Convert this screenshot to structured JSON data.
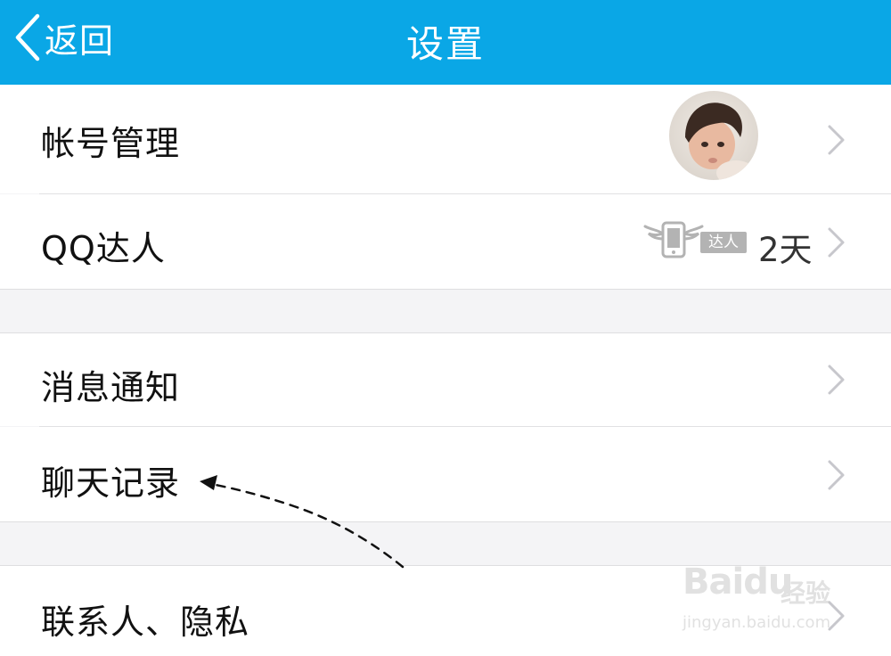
{
  "header": {
    "back_label": "返回",
    "title": "设置",
    "background": "#0aa7e6"
  },
  "rows": {
    "account": {
      "label": "帐号管理"
    },
    "qq_talent": {
      "label": "QQ达人",
      "badge_text": "达人",
      "days": "2天"
    },
    "notifications": {
      "label": "消息通知"
    },
    "chat_history": {
      "label": "聊天记录"
    },
    "contacts_privacy": {
      "label": "联系人、隐私"
    }
  },
  "icons": {
    "back": "chevron-left-icon",
    "row_arrow": "chevron-right-icon",
    "talent_badge": "winged-phone-icon"
  },
  "annotation": {
    "type": "dashed-arrow",
    "target": "聊天记录"
  },
  "watermark": {
    "logo": "Baidu",
    "brand": "经验",
    "url": "jingyan.baidu.com"
  }
}
